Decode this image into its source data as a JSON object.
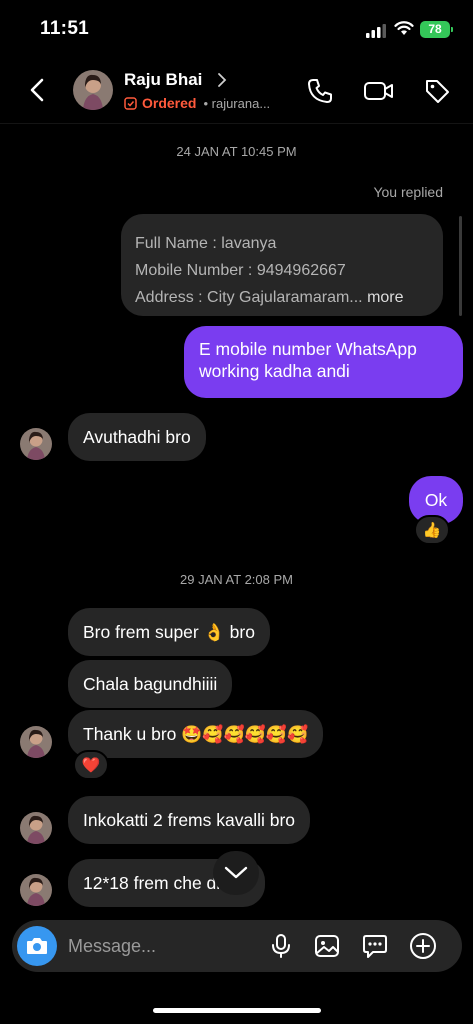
{
  "status": {
    "time": "11:51",
    "battery": "78"
  },
  "header": {
    "name": "Raju Bhai",
    "ordered": "Ordered",
    "handle": "• rajurana..."
  },
  "chat": {
    "date1": "24 JAN AT 10:45 PM",
    "you_replied": "You replied",
    "quote": {
      "line1": "Full Name : lavanya",
      "line2": "Mobile Number  :  9494962667",
      "line3": "Address  : City Gajularamaram...",
      "more": "more"
    },
    "m1": {
      "line1": "E mobile number WhatsApp",
      "line2": "working kadha andi"
    },
    "m2": "Avuthadhi bro",
    "m3": "Ok",
    "m3_reaction": "👍",
    "date2": "29 JAN AT 2:08 PM",
    "m4": {
      "pre": "Bro frem super",
      "emoji": "👌",
      "post": "bro"
    },
    "m5": "Chala bagundhiiii",
    "m6": {
      "text": "Thank u bro",
      "emojis": "🤩🥰🥰🥰🥰🥰"
    },
    "m6_reaction": "❤️",
    "m7": "Inkokatti 2 frems kavalli bro",
    "m8": "12*18 frem che   di bro"
  },
  "composer": {
    "placeholder": "Message..."
  }
}
